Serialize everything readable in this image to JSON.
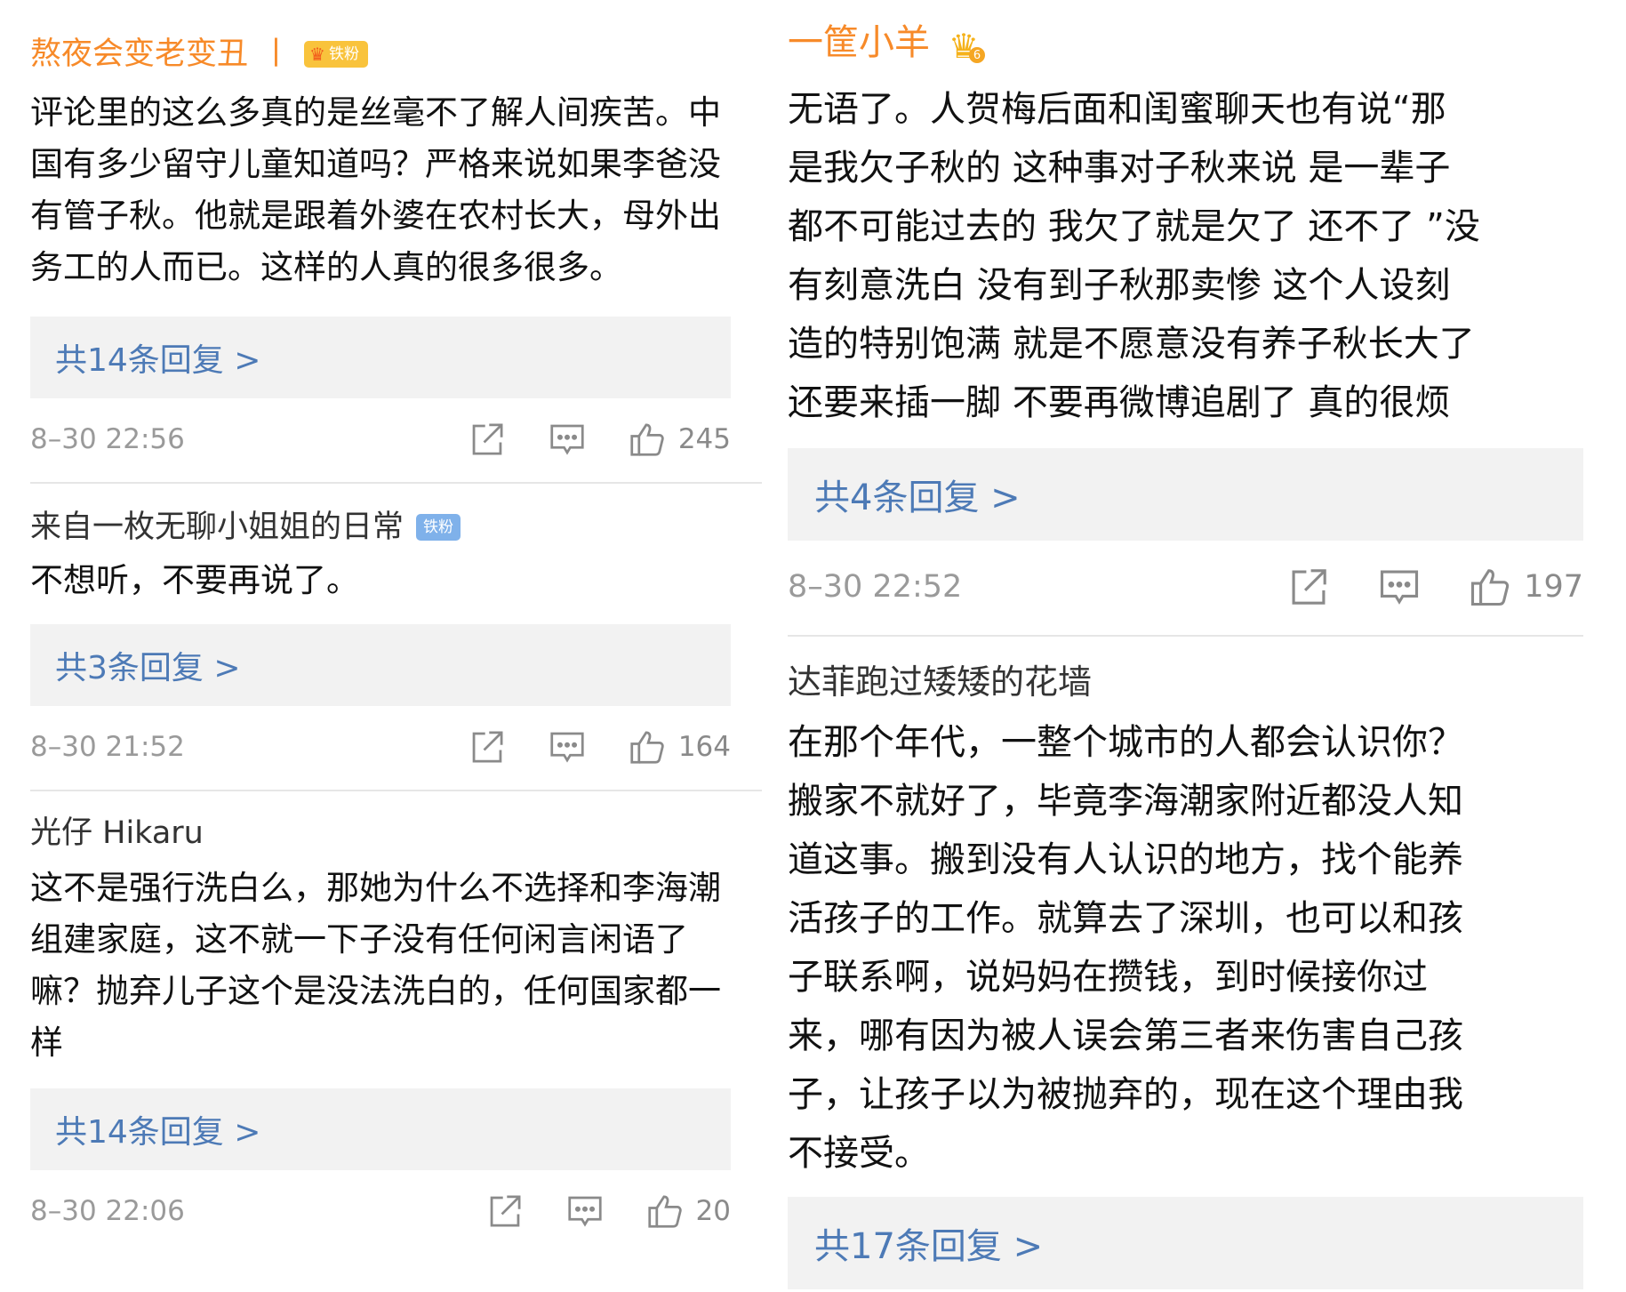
{
  "colors": {
    "author_highlight": "#f78a29",
    "author_default": "#333333",
    "reply_link": "#4d7ab6",
    "reply_bg": "#f2f2f2",
    "meta_gray": "#9a9a9a"
  },
  "left_column": [
    {
      "author": "熬夜会变老变丑",
      "separator": "丨",
      "badge": "铁粉",
      "text": "评论里的这么多真的是丝毫不了解人间疾苦。中国有多少留守儿童知道吗？严格来说如果李爸没有管子秋。他就是跟着外婆在农村长大，母外出务工的人而已。这样的人真的很多很多。",
      "reply_label": "共14条回复 >",
      "time": "8–30 22:56",
      "likes": "245"
    },
    {
      "author": "来自一枚无聊小姐姐的日常",
      "badge": "铁粉",
      "text": "不想听，不要再说了。",
      "reply_label": "共3条回复 >",
      "time": "8–30 21:52",
      "likes": "164"
    },
    {
      "author": "光仔 Hikaru",
      "text": "这不是强行洗白么，那她为什么不选择和李海潮组建家庭，这不就一下子没有任何闲言闲语了嘛？抛弃儿子这个是没法洗白的，任何国家都一样",
      "reply_label": "共14条回复 >",
      "time": "8–30 22:06",
      "likes": "20"
    }
  ],
  "right_column": [
    {
      "author": "一筐小羊",
      "badge_level": "6",
      "text_lines": [
        "无语了。人贺梅后面和闺蜜聊天也有说“那",
        "是我欠子秋的 这种事对子秋来说 是一辈子",
        "都不可能过去的 我欠了就是欠了 还不了 ”没",
        "有刻意洗白 没有到子秋那卖惨 这个人设刻",
        "造的特别饱满 就是不愿意没有养子秋长大了",
        "还要来插一脚 不要再微博追剧了 真的很烦"
      ],
      "reply_label": "共4条回复 >",
      "time": "8–30 22:52",
      "likes": "197"
    },
    {
      "author": "达菲跑过矮矮的花墙",
      "text_lines": [
        "在那个年代，一整个城市的人都会认识你？",
        "搬家不就好了，毕竟李海潮家附近都没人知",
        "道这事。搬到没有人认识的地方，找个能养",
        "活孩子的工作。就算去了深圳，也可以和孩",
        "子联系啊，说妈妈在攒钱，到时候接你过",
        "来，哪有因为被人误会第三者来伤害自己孩",
        "子，让孩子以为被抛弃的，现在这个理由我",
        "不接受。"
      ],
      "reply_label": "共17条回复 >"
    }
  ]
}
